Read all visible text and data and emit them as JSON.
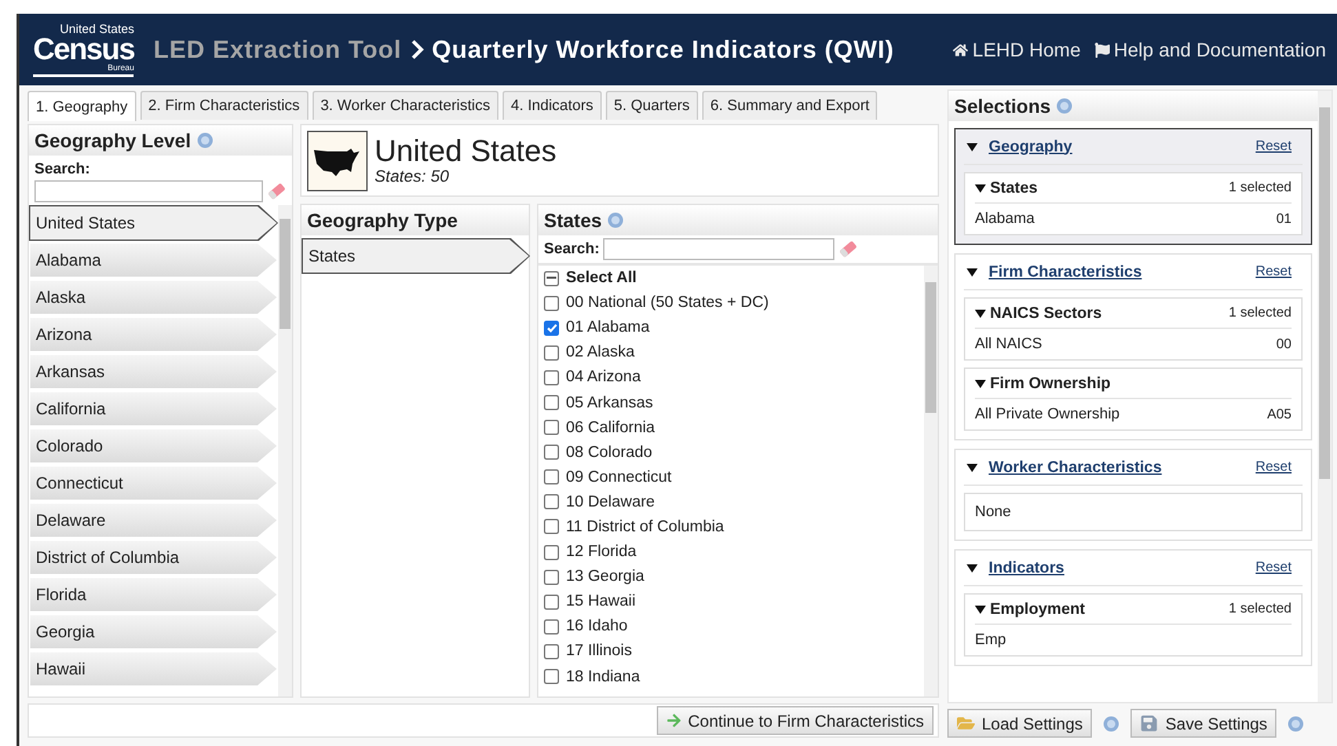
{
  "header": {
    "logo": {
      "top": "United States",
      "main": "Census",
      "bottom": "Bureau"
    },
    "app_name": "LED Extraction Tool",
    "page_title": "Quarterly Workforce Indicators (QWI)",
    "links": [
      {
        "kind": "home",
        "label": "LEHD Home"
      },
      {
        "kind": "help",
        "label": "Help and Documentation"
      }
    ]
  },
  "tabs": [
    {
      "label": "1. Geography",
      "selected": true
    },
    {
      "label": "2. Firm Characteristics",
      "selected": false
    },
    {
      "label": "3. Worker Characteristics",
      "selected": false
    },
    {
      "label": "4. Indicators",
      "selected": false
    },
    {
      "label": "5. Quarters",
      "selected": false
    },
    {
      "label": "6. Summary and Export",
      "selected": false
    }
  ],
  "geography_level": {
    "title": "Geography Level",
    "search_label": "Search:",
    "items": [
      {
        "label": "United States",
        "selected": true
      },
      {
        "label": "Alabama",
        "selected": false
      },
      {
        "label": "Alaska",
        "selected": false
      },
      {
        "label": "Arizona",
        "selected": false
      },
      {
        "label": "Arkansas",
        "selected": false
      },
      {
        "label": "California",
        "selected": false
      },
      {
        "label": "Colorado",
        "selected": false
      },
      {
        "label": "Connecticut",
        "selected": false
      },
      {
        "label": "Delaware",
        "selected": false
      },
      {
        "label": "District of Columbia",
        "selected": false
      },
      {
        "label": "Florida",
        "selected": false
      },
      {
        "label": "Georgia",
        "selected": false
      },
      {
        "label": "Hawaii",
        "selected": false
      }
    ]
  },
  "summary": {
    "title": "United States",
    "subtitle": "States: 50"
  },
  "geography_type": {
    "title": "Geography Type",
    "items": [
      {
        "label": "States",
        "selected": true
      }
    ]
  },
  "states": {
    "title": "States",
    "search_label": "Search:",
    "select_all": {
      "label": "Select All",
      "indeterminate": true
    },
    "items": [
      {
        "label": "00 National (50 States + DC)",
        "checked": false
      },
      {
        "label": "01 Alabama",
        "checked": true
      },
      {
        "label": "02 Alaska",
        "checked": false
      },
      {
        "label": "04 Arizona",
        "checked": false
      },
      {
        "label": "05 Arkansas",
        "checked": false
      },
      {
        "label": "06 California",
        "checked": false
      },
      {
        "label": "08 Colorado",
        "checked": false
      },
      {
        "label": "09 Connecticut",
        "checked": false
      },
      {
        "label": "10 Delaware",
        "checked": false
      },
      {
        "label": "11 District of Columbia",
        "checked": false
      },
      {
        "label": "12 Florida",
        "checked": false
      },
      {
        "label": "13 Georgia",
        "checked": false
      },
      {
        "label": "15 Hawaii",
        "checked": false
      },
      {
        "label": "16 Idaho",
        "checked": false
      },
      {
        "label": "17 Illinois",
        "checked": false
      },
      {
        "label": "18 Indiana",
        "checked": false
      }
    ]
  },
  "continue_button": "Continue to Firm Characteristics",
  "selections": {
    "title": "Selections",
    "sections": [
      {
        "title": "Geography",
        "reset": "Reset",
        "highlighted": true,
        "expanded": true,
        "groups": [
          {
            "title": "States",
            "expanded": true,
            "count": "1 selected",
            "rows": [
              {
                "label": "Alabama",
                "code": "01"
              }
            ]
          }
        ]
      },
      {
        "title": "Firm Characteristics",
        "reset": "Reset",
        "highlighted": false,
        "expanded": true,
        "groups": [
          {
            "title": "NAICS Sectors",
            "expanded": true,
            "count": "1 selected",
            "rows": [
              {
                "label": "All NAICS",
                "code": "00"
              }
            ]
          },
          {
            "title": "Firm Ownership",
            "expanded": true,
            "rows": [
              {
                "label": "All Private Ownership",
                "code": "A05"
              }
            ]
          }
        ]
      },
      {
        "title": "Worker Characteristics",
        "reset": "Reset",
        "highlighted": false,
        "expanded": true,
        "groups": [
          {
            "rows": [
              {
                "label": "None"
              }
            ]
          }
        ]
      },
      {
        "title": "Indicators",
        "reset": "Reset",
        "highlighted": false,
        "expanded": true,
        "groups": [
          {
            "title": "Employment",
            "expanded": true,
            "count": "1 selected",
            "rows": [
              {
                "label": "Emp"
              }
            ]
          }
        ]
      }
    ]
  },
  "footer_buttons": [
    {
      "kind": "load",
      "label": "Load Settings"
    },
    {
      "kind": "save",
      "label": "Save Settings"
    }
  ]
}
